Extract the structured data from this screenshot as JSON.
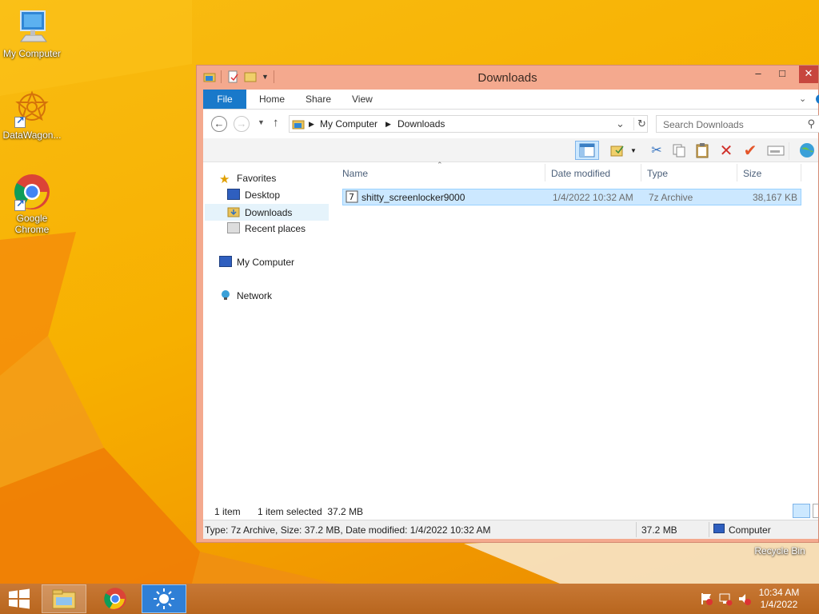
{
  "desktop": {
    "icons": [
      {
        "label": "My Computer"
      },
      {
        "label": "DataWagon..."
      },
      {
        "label": "Google Chrome"
      },
      {
        "label": "Recycle Bin"
      }
    ]
  },
  "window": {
    "title": "Downloads",
    "controls": {
      "minimize": "–",
      "maximize": "□",
      "close": "✕"
    }
  },
  "ribbon": {
    "tabs": [
      "File",
      "Home",
      "Share",
      "View"
    ]
  },
  "address": {
    "crumbs": [
      "My Computer",
      "Downloads"
    ],
    "search_placeholder": "Search Downloads"
  },
  "nav": {
    "favorites": "Favorites",
    "desktop": "Desktop",
    "downloads": "Downloads",
    "recent": "Recent places",
    "computer": "My Computer",
    "network": "Network"
  },
  "columns": {
    "name": "Name",
    "date": "Date modified",
    "type": "Type",
    "size": "Size"
  },
  "files": [
    {
      "name": "shitty_screenlocker9000",
      "date": "1/4/2022 10:32 AM",
      "type": "7z Archive",
      "size": "38,167 KB"
    }
  ],
  "status": {
    "count": "1 item",
    "selected": "1 item selected  37.2 MB"
  },
  "details": {
    "info": "Type: 7z Archive, Size: 37.2 MB, Date modified: 1/4/2022 10:32 AM",
    "size": "37.2 MB",
    "location": "Computer"
  },
  "taskbar": {
    "time": "10:34 AM",
    "date": "1/4/2022"
  },
  "colors": {
    "accent": "#1979ca",
    "window_frame": "#f4a98e",
    "selection": "#cce8ff"
  }
}
